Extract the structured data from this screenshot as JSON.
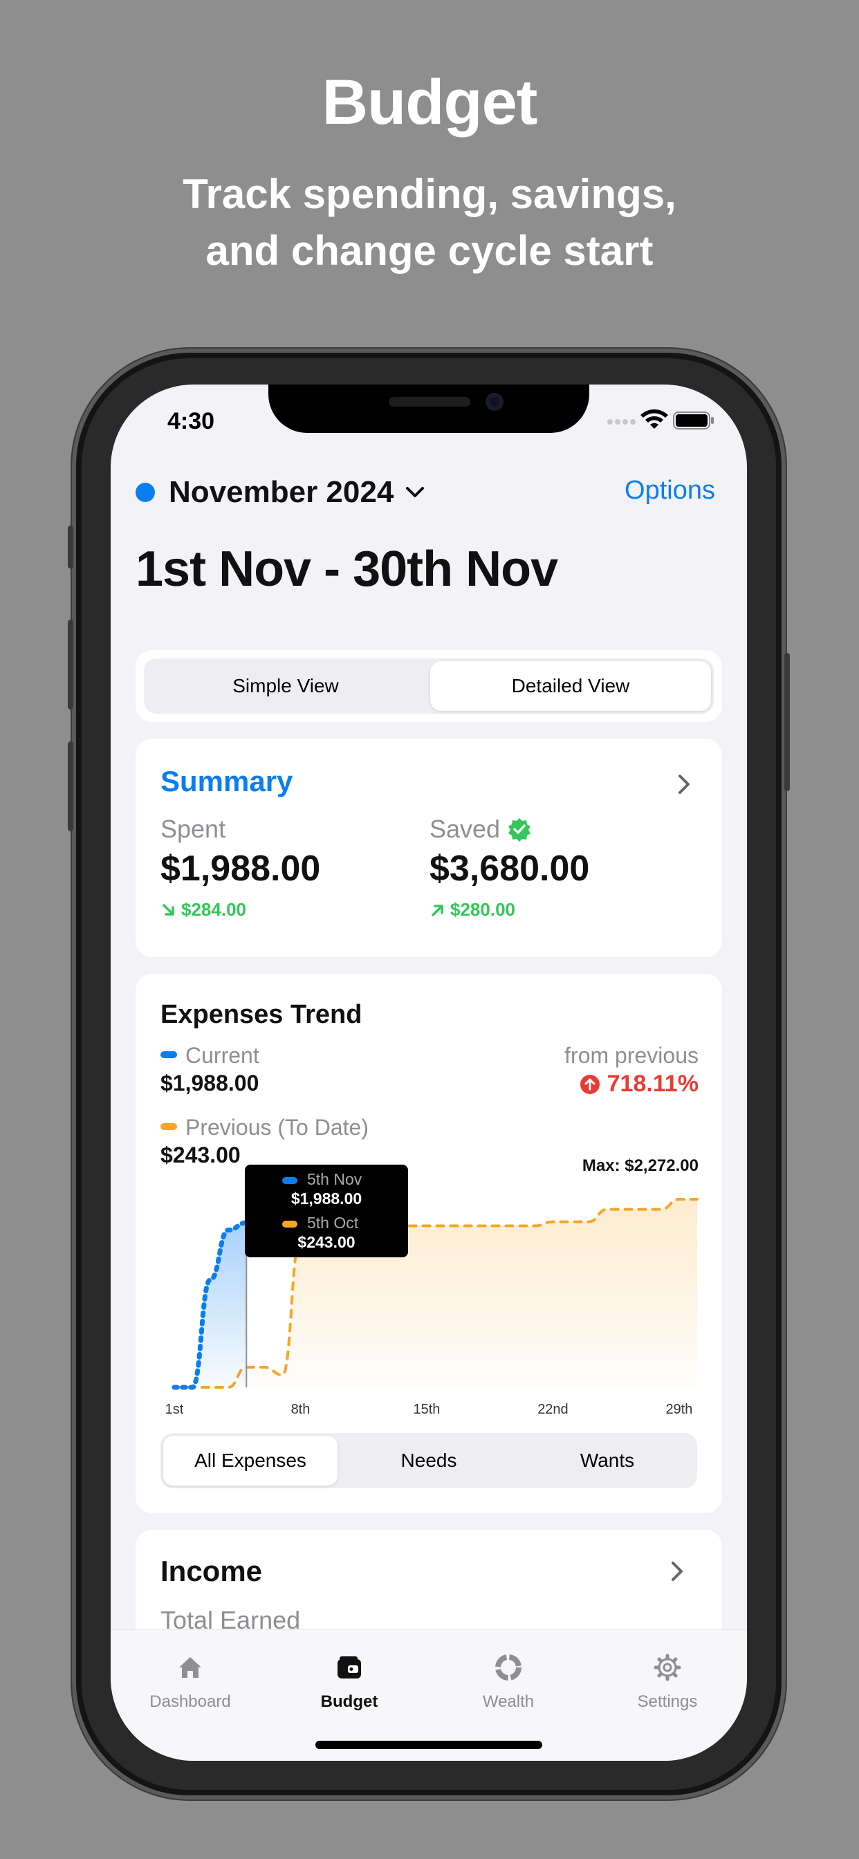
{
  "hero": {
    "title": "Budget",
    "subtitle_line1": "Track spending, savings,",
    "subtitle_line2": "and change cycle start"
  },
  "status_bar": {
    "time": "4:30"
  },
  "header": {
    "month": "November 2024",
    "options_label": "Options",
    "range": "1st Nov - 30th Nov",
    "month_dot_color": "#0a7ef0"
  },
  "view_toggle": {
    "simple": "Simple View",
    "detailed": "Detailed View",
    "selected": "Detailed View"
  },
  "summary": {
    "title": "Summary",
    "spent_label": "Spent",
    "spent_value": "$1,988.00",
    "spent_change": "$284.00",
    "saved_label": "Saved",
    "saved_value": "$3,680.00",
    "saved_change": "$280.00"
  },
  "trend": {
    "title": "Expenses Trend",
    "current_label": "Current",
    "current_value": "$1,988.00",
    "from_previous_label": "from previous",
    "pct_change": "718.11%",
    "previous_label": "Previous (To Date)",
    "previous_value": "$243.00",
    "max_label": "Max: $2,272.00",
    "tooltip": {
      "current_date": "5th Nov",
      "current_value": "$1,988.00",
      "previous_date": "5th Oct",
      "previous_value": "$243.00"
    },
    "filters": [
      "All Expenses",
      "Needs",
      "Wants"
    ],
    "selected_filter": "All Expenses",
    "colors": {
      "current": "#0a7ef0",
      "previous": "#f5a623",
      "negative": "#ea3b33"
    }
  },
  "chart_data": {
    "type": "line",
    "x_tick_labels": [
      "1st",
      "8th",
      "15th",
      "22nd",
      "29th"
    ],
    "x": [
      1,
      2,
      3,
      4,
      5,
      6,
      7,
      8,
      9,
      10,
      11,
      12,
      13,
      14,
      15,
      16,
      17,
      18,
      19,
      20,
      21,
      22,
      23,
      24,
      25,
      26,
      27,
      28,
      29,
      30
    ],
    "series": [
      {
        "name": "Current",
        "values": [
          0,
          0,
          1300,
          1900,
          1988
        ]
      },
      {
        "name": "Previous (To Date)",
        "values": [
          0,
          0,
          0,
          0,
          243,
          243,
          150,
          1800,
          1950,
          1950,
          1950,
          1950,
          1950,
          1950,
          1950,
          1950,
          1950,
          1950,
          1950,
          1950,
          1950,
          2000,
          2000,
          2000,
          2150,
          2150,
          2150,
          2150,
          2272,
          2272
        ]
      }
    ],
    "ylim": [
      0,
      2272
    ]
  },
  "income": {
    "title": "Income",
    "total_earned_label": "Total Earned"
  },
  "tabbar": {
    "items": [
      {
        "label": "Dashboard",
        "icon": "house-icon"
      },
      {
        "label": "Budget",
        "icon": "wallet-icon"
      },
      {
        "label": "Wealth",
        "icon": "pie-icon"
      },
      {
        "label": "Settings",
        "icon": "gear-icon"
      }
    ],
    "selected": "Budget"
  }
}
